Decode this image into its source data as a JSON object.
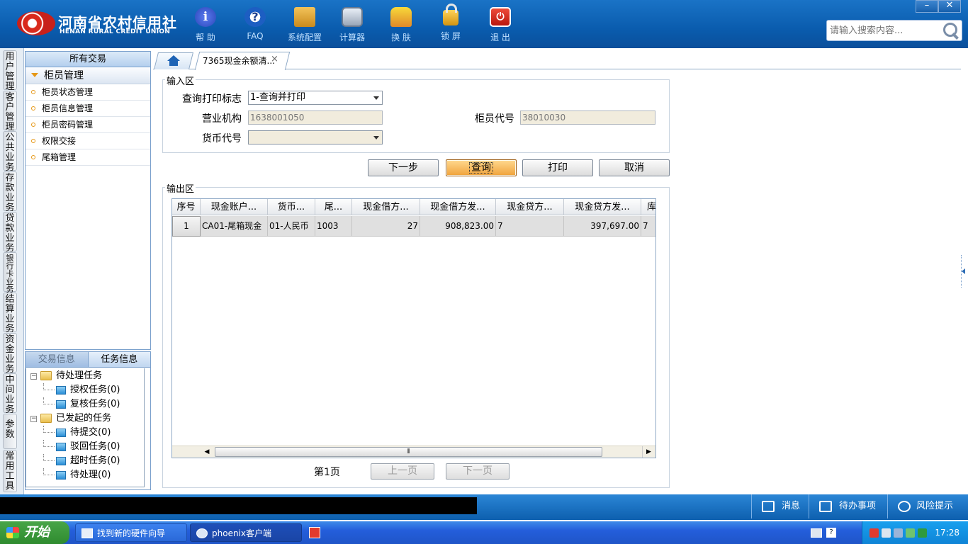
{
  "header": {
    "logo_cn": "河南省农村信用社",
    "logo_en": "HENAN RURAL CREDIT UNION",
    "tools": [
      {
        "label": "帮 助",
        "icon": "help-icon",
        "glyph": "i"
      },
      {
        "label": "FAQ",
        "icon": "faq-icon",
        "glyph": "?"
      },
      {
        "label": "系统配置",
        "icon": "toolbox-icon"
      },
      {
        "label": "计算器",
        "icon": "calculator-icon"
      },
      {
        "label": "换 肤",
        "icon": "tshirt-icon"
      },
      {
        "label": "锁 屏",
        "icon": "lock-icon"
      },
      {
        "label": "退 出",
        "icon": "power-icon",
        "glyph": "⏻"
      }
    ],
    "search_placeholder": "请输入搜索内容...",
    "win_minimize": "–",
    "win_close": "✕"
  },
  "vtabs": [
    "用户管理",
    "客户管理",
    "公共业务",
    "存款业务",
    "贷款业务",
    "银行卡业务",
    "结算业务",
    "资金业务",
    "中间业务",
    "参数",
    "常用工具"
  ],
  "nav": {
    "header": "所有交易",
    "group": "柜员管理",
    "items": [
      "柜员状态管理",
      "柜员信息管理",
      "柜员密码管理",
      "权限交接",
      "尾箱管理"
    ]
  },
  "task_panel": {
    "tab_trade": "交易信息",
    "tab_task": "任务信息",
    "tree": [
      {
        "label": "待处理任务",
        "level": 0
      },
      {
        "label": "授权任务(0)",
        "level": 1
      },
      {
        "label": "复核任务(0)",
        "level": 1
      },
      {
        "label": "已发起的任务",
        "level": 0
      },
      {
        "label": "待提交(0)",
        "level": 1
      },
      {
        "label": "驳回任务(0)",
        "level": 1
      },
      {
        "label": "超时任务(0)",
        "level": 1
      },
      {
        "label": "待处理(0)",
        "level": 1
      }
    ]
  },
  "tabs": {
    "active_label": "7365现金余额清...",
    "close": "×"
  },
  "input_area": {
    "legend": "输入区",
    "query_print_label": "查询打印标志",
    "query_print_value": "1-查询并打印",
    "org_label": "营业机构",
    "org_value": "1638001050",
    "teller_label": "柜员代号",
    "teller_value": "38010030",
    "currency_label": "货币代号",
    "currency_value": ""
  },
  "buttons": {
    "next": "下一步",
    "query": "查询",
    "print": "打印",
    "cancel": "取消"
  },
  "output_area": {
    "legend": "输出区",
    "columns": [
      "序号",
      "现金账户...",
      "货币...",
      "尾...",
      "现金借方...",
      "现金借方发...",
      "现金贷方...",
      "现金贷方发...",
      "库"
    ],
    "rows": [
      [
        "1",
        "CA01-尾箱现金",
        "01-人民币",
        "1003",
        "27",
        "908,823.00",
        "7",
        "397,697.00",
        "7"
      ]
    ],
    "scroll_grip": "⦀"
  },
  "pager": {
    "page_label": "第1页",
    "prev": "上一页",
    "next": "下一页"
  },
  "status_bar": {
    "message": "消息",
    "todo": "待办事项",
    "risk": "风险提示"
  },
  "taskbar": {
    "start": "开始",
    "tasks": [
      "找到新的硬件向导",
      "phoenix客户端"
    ],
    "clock": "17:28"
  }
}
